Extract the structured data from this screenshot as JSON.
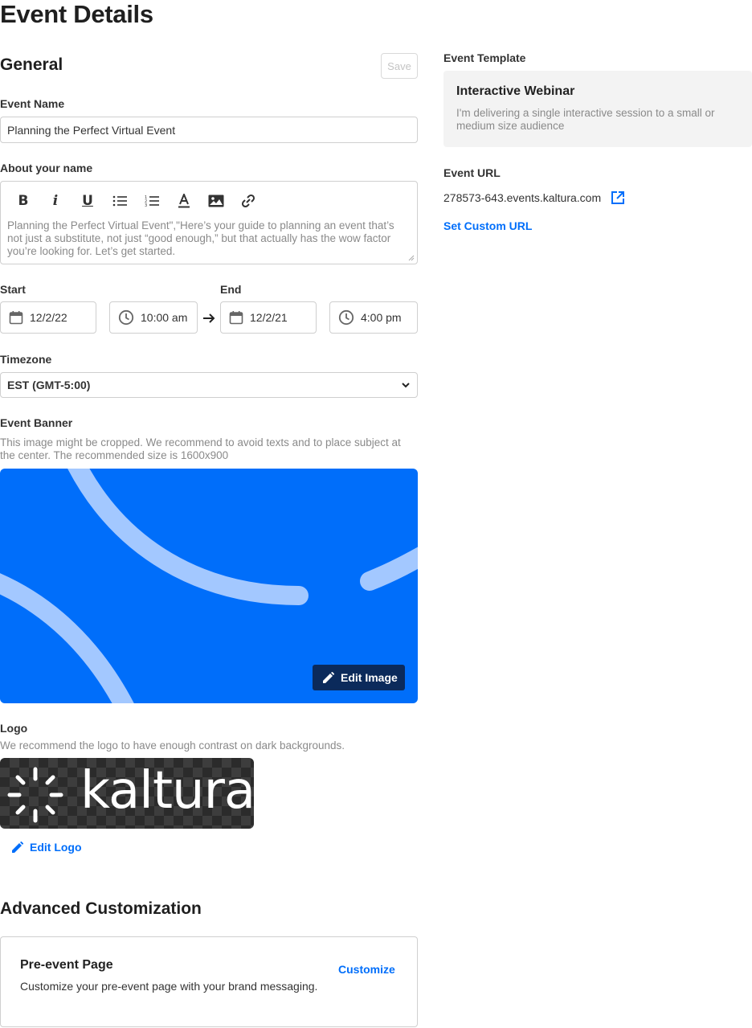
{
  "page": {
    "title": "Event Details"
  },
  "general": {
    "title": "General",
    "save_label": "Save",
    "event_name": {
      "label": "Event Name",
      "value": "Planning the Perfect Virtual Event"
    },
    "about": {
      "label": "About your name",
      "toolbar": [
        "bold-icon",
        "italic-icon",
        "underline-icon",
        "bulleted-list-icon",
        "numbered-list-icon",
        "text-color-icon",
        "image-icon",
        "link-icon"
      ],
      "text": "Planning the Perfect Virtual Event\",\"Here’s your guide to planning an event that’s not just a substitute, not just “good enough,” but that actually has the wow factor you’re looking for. Let’s get started."
    },
    "start": {
      "label": "Start",
      "date": "12/2/22",
      "time": "10:00 am"
    },
    "end": {
      "label": "End",
      "date": "12/2/21",
      "time": "4:00 pm"
    },
    "timezone": {
      "label": "Timezone",
      "value": "EST (GMT-5:00)"
    },
    "banner": {
      "label": "Event Banner",
      "help": "This image might be cropped. We recommend to avoid texts and to place subject at the center. The recommended size is 1600x900",
      "edit_label": "Edit Image",
      "color": "#006efa"
    },
    "logo": {
      "label": "Logo",
      "help": "We recommend the logo to have enough contrast on dark backgrounds.",
      "logo_text": "kaltura",
      "edit_label": "Edit Logo"
    }
  },
  "advanced": {
    "title": "Advanced Customization",
    "card": {
      "title": "Pre-event Page",
      "description": "Customize your pre-event page with your brand messaging.",
      "action": "Customize"
    }
  },
  "sidebar": {
    "template": {
      "label": "Event Template",
      "name": "Interactive Webinar",
      "description": "I'm delivering a single interactive session to a small or medium size audience"
    },
    "url": {
      "label": "Event URL",
      "value": "278573-643.events.kaltura.com",
      "custom_label": "Set Custom URL"
    }
  },
  "colors": {
    "accent": "#006efa",
    "dark_button": "#0b2a5b"
  }
}
